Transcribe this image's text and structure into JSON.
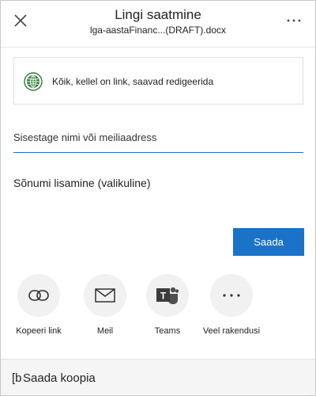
{
  "header": {
    "title": "Lingi saatmine",
    "subtitle": "lga-aastaFinanc...(DRAFT).docx"
  },
  "icons": {
    "close": "close-icon",
    "more": "more-icon",
    "globe": "globe-icon",
    "link": "link-icon",
    "mail": "mail-icon",
    "teams": "teams-icon",
    "ellipsis": "ellipsis-icon",
    "copy": "copy-icon"
  },
  "link_settings": {
    "text": "Kõik, kellel on link, saavad redigeerida"
  },
  "recipient": {
    "placeholder": "Sisestage nimi või meiliaadress",
    "value": ""
  },
  "message": {
    "placeholder": "Sõnumi lisamine (valikuline)",
    "value": ""
  },
  "send": {
    "label": "Saada"
  },
  "apps": [
    {
      "label": "Kopeeri link"
    },
    {
      "label": "Meil"
    },
    {
      "label": "Teams"
    },
    {
      "label": "Veel rakendusi"
    }
  ],
  "footer": {
    "icon_glyph": "[b",
    "label": "Saada koopia"
  },
  "colors": {
    "accent": "#1a73c9",
    "globe": "#2e7d32",
    "teams": "#4f4f4f"
  }
}
